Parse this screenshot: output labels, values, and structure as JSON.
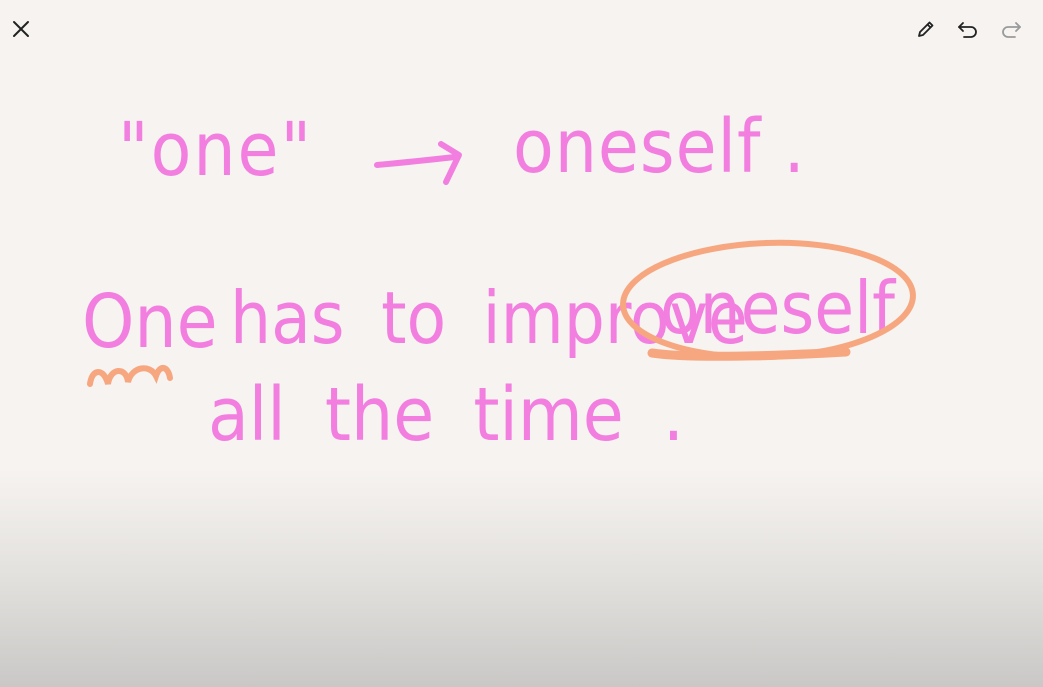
{
  "toolbar": {
    "close_icon": "close-icon",
    "pen_icon": "pencil-icon",
    "undo_icon": "undo-icon",
    "redo_icon": "redo-icon"
  },
  "note": {
    "line1_left": "\"one\"",
    "line1_right": "oneself .",
    "line2_word1": "One",
    "line2_rest": "has to improve",
    "line2_circled": "oneself",
    "line3": "all the time ."
  },
  "colors": {
    "background": "#f6f3f0",
    "ink_pink": "#f27ee0",
    "ink_orange": "#f7a77f",
    "icon": "#222222",
    "icon_disabled": "#9a9a9a"
  }
}
